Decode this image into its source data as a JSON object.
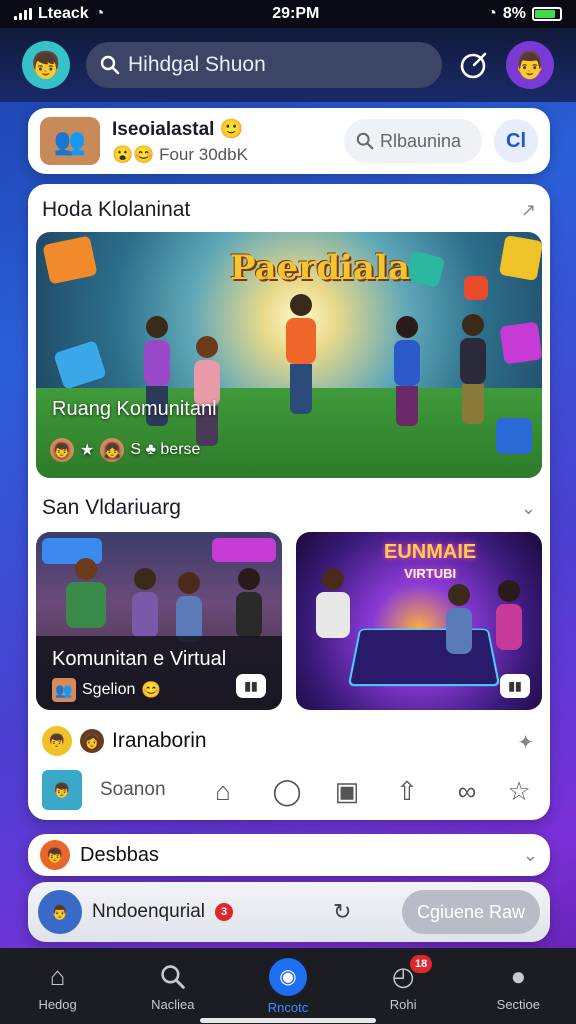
{
  "status": {
    "carrier": "Lteack",
    "time": "29:PM",
    "battery": "8%"
  },
  "header": {
    "search_placeholder": "Hihdgal Shuon"
  },
  "profile": {
    "name": "Iseoialastal",
    "subtitle": "Four 30dbK",
    "search_label": "Rlbaunina",
    "camera_label": "Cl"
  },
  "feed": {
    "section_title": "Hoda Klolaninat",
    "hero": {
      "title": "Paerdiala",
      "label": "Ruang Komunitanl",
      "meta": "S ♣ berse"
    }
  },
  "section2": {
    "title": "San Vldariuarg"
  },
  "thumbs": [
    {
      "title": "Komunitan e Virtual",
      "meta": "Sgelion",
      "bubble": "▮▮"
    },
    {
      "title": "EUNMAIE",
      "subtitle": "VIRTUBI",
      "bubble": "▮▮"
    }
  ],
  "interaction": {
    "name": "Iranaborin",
    "comment_placeholder": "Soanon"
  },
  "bar": {
    "label": "Desbbas"
  },
  "compose": {
    "name": "Nndoenqurial",
    "badge": "3",
    "button": "Cgiuene Raw"
  },
  "nav": [
    {
      "label": "Hedog",
      "icon": "home-icon",
      "active": false
    },
    {
      "label": "Nacliea",
      "icon": "search-icon",
      "active": false
    },
    {
      "label": "Rncotc",
      "icon": "chat-icon",
      "active": true
    },
    {
      "label": "Rohi",
      "icon": "clock-icon",
      "badge": "18",
      "active": false
    },
    {
      "label": "Sectioe",
      "icon": "profile-icon",
      "active": false
    }
  ],
  "colors": {
    "accent": "#1d6ef0",
    "nav_bg": "#1c1d22",
    "badge": "#e0262e"
  }
}
